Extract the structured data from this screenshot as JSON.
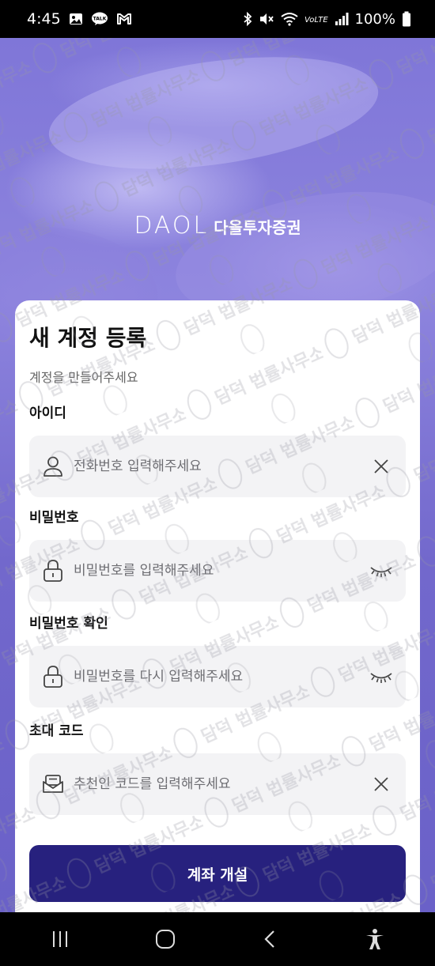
{
  "status_bar": {
    "time": "4:45",
    "battery": "100%",
    "left_icons": [
      "gallery-icon",
      "kakaotalk-icon",
      "gmail-icon"
    ],
    "right_icons": [
      "bluetooth-icon",
      "mute-icon",
      "wifi-icon",
      "volte-icon",
      "signal-icon",
      "battery-icon"
    ]
  },
  "brand": {
    "latin": "DAOL",
    "korean": "다올투자증권"
  },
  "watermark": {
    "text": "담덕 법률사무소",
    "seal": "담덕"
  },
  "form": {
    "title": "새 계정 등록",
    "subtitle": "계정을 만들어주세요",
    "fields": [
      {
        "label": "아이디",
        "placeholder": "전화번호 입력해주세요",
        "icon": "user-icon",
        "trailing_icon": "clear-icon"
      },
      {
        "label": "비밀번호",
        "placeholder": "비밀번호를 입력해주세요",
        "icon": "lock-icon",
        "trailing_icon": "eye-closed-icon"
      },
      {
        "label": "비밀번호 확인",
        "placeholder": "비밀번호를 다시 입력해주세요",
        "icon": "lock-icon",
        "trailing_icon": "eye-closed-icon"
      },
      {
        "label": "초대 코드",
        "placeholder": "추천인 코드를 입력해주세요",
        "icon": "envelope-icon",
        "trailing_icon": "clear-icon"
      }
    ],
    "submit_label": "계좌 개설"
  },
  "nav_bar": {
    "buttons": [
      "recents-icon",
      "home-icon",
      "back-icon",
      "accessibility-icon"
    ]
  },
  "colors": {
    "brand_purple": "#7d74d6",
    "button_navy": "#27217e",
    "field_bg": "#f3f3f5"
  }
}
